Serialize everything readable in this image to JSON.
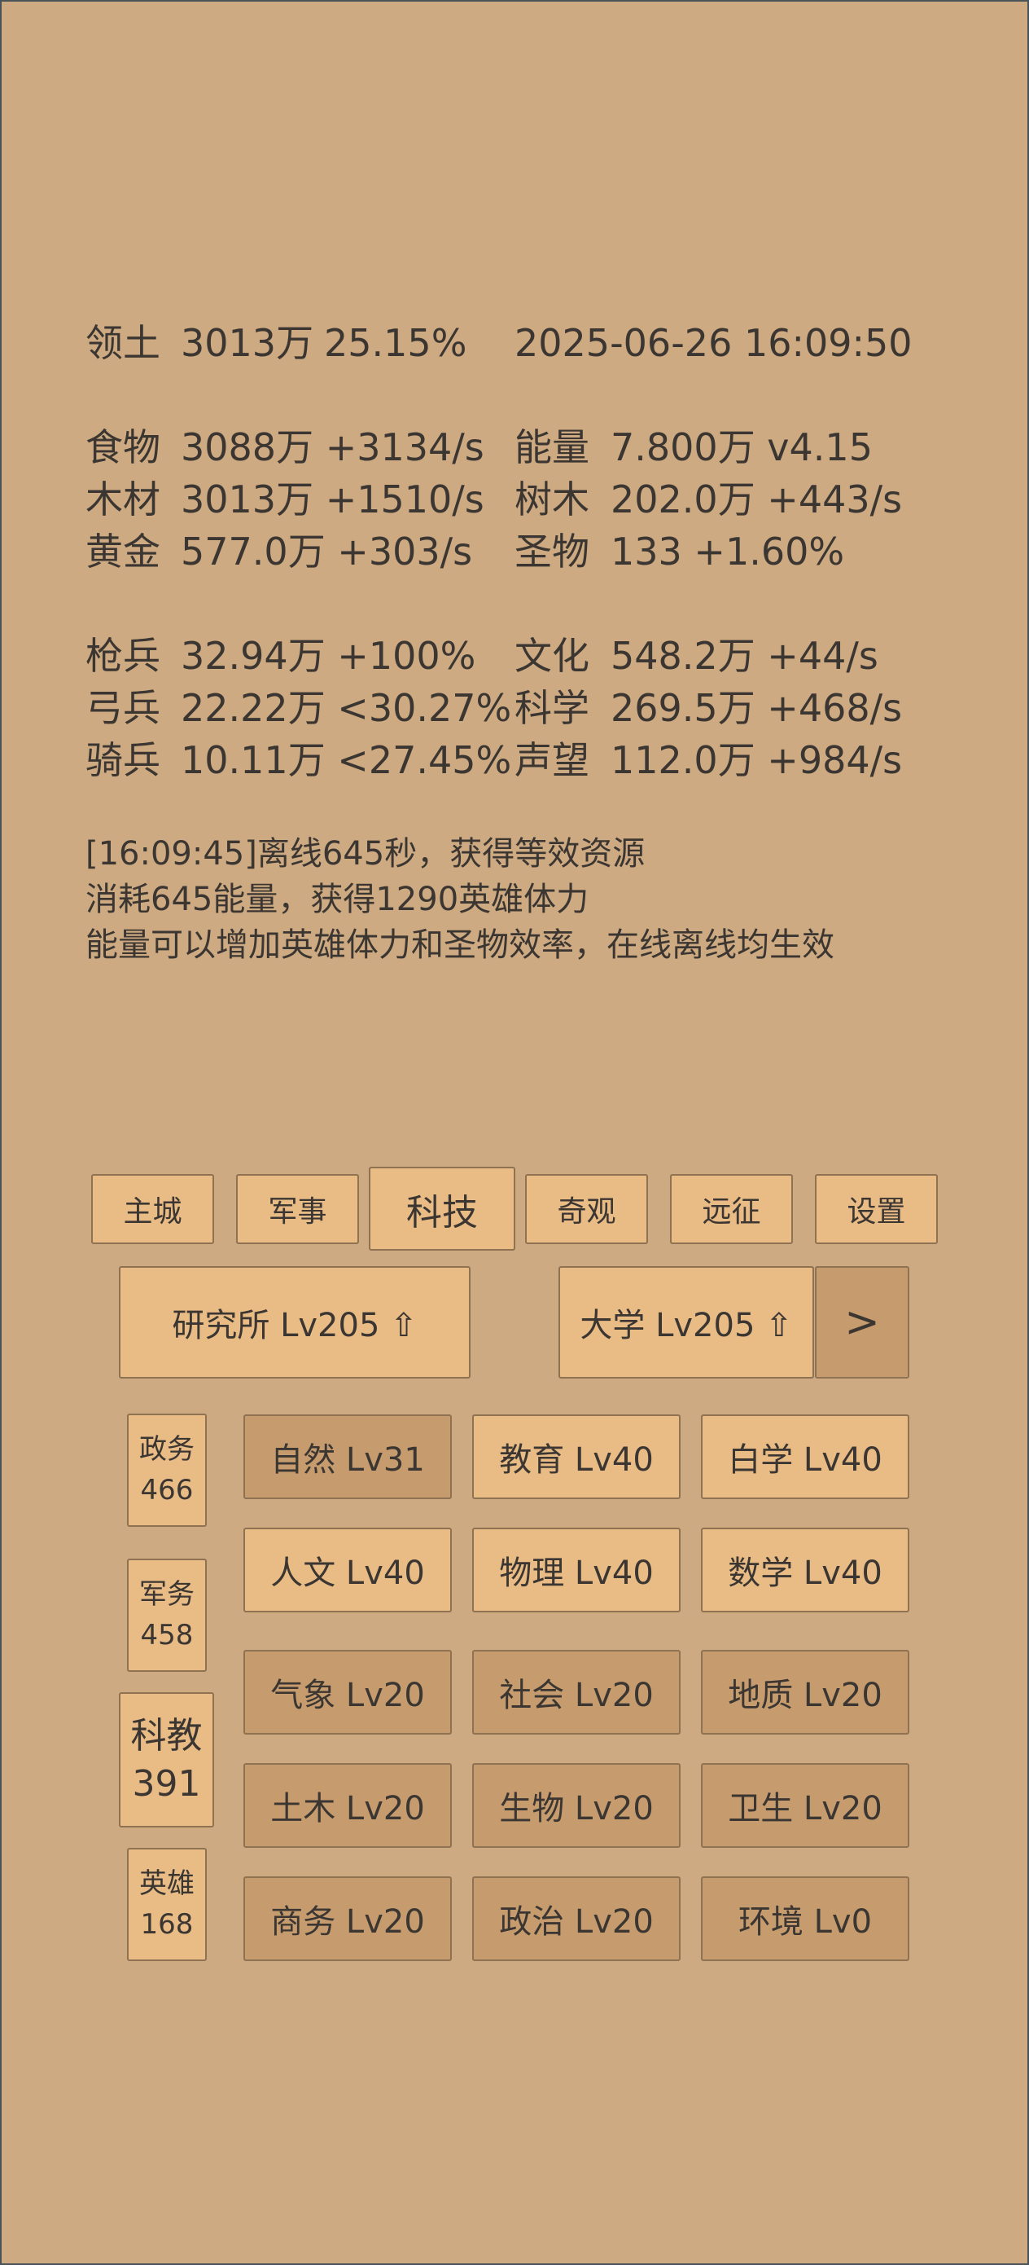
{
  "territory": {
    "label": "领土",
    "value": "3013万",
    "ratio": "25.15%"
  },
  "datetime": "2025-06-26 16:09:50",
  "resources": [
    {
      "label": "食物",
      "value": "3088万 +3134/s"
    },
    {
      "label": "木材",
      "value": "3013万 +1510/s"
    },
    {
      "label": "黄金",
      "value": "577.0万 +303/s"
    },
    {
      "label": "能量",
      "value": "7.800万  v4.15"
    },
    {
      "label": "树木",
      "value": "202.0万 +443/s"
    },
    {
      "label": "圣物",
      "value": "133 +1.60%"
    }
  ],
  "military": [
    {
      "label": "枪兵",
      "value": "32.94万 +100%"
    },
    {
      "label": "弓兵",
      "value": "22.22万 <30.27%"
    },
    {
      "label": "骑兵",
      "value": "10.11万 <27.45%"
    },
    {
      "label": "文化",
      "value": "548.2万 +44/s"
    },
    {
      "label": "科学",
      "value": "269.5万 +468/s"
    },
    {
      "label": "声望",
      "value": "112.0万 +984/s"
    }
  ],
  "log": [
    "[16:09:45]离线645秒，获得等效资源",
    "消耗645能量，获得1290英雄体力",
    "能量可以增加英雄体力和圣物效率，在线离线均生效"
  ],
  "tabs": [
    "主城",
    "军事",
    "科技",
    "奇观",
    "远征",
    "设置"
  ],
  "active_tab": "科技",
  "buildings": {
    "institute": "研究所 Lv205 ⇧",
    "university": "大学 Lv205 ⇧",
    "next": ">"
  },
  "side_menu": [
    {
      "label": "政务",
      "count": "466"
    },
    {
      "label": "军务",
      "count": "458"
    },
    {
      "label": "科教",
      "count": "391"
    },
    {
      "label": "英雄",
      "count": "168"
    }
  ],
  "techs": [
    "自然 Lv31",
    "教育 Lv40",
    "白学 Lv40",
    "人文 Lv40",
    "物理 Lv40",
    "数学 Lv40",
    "气象 Lv20",
    "社会 Lv20",
    "地质 Lv20",
    "土木 Lv20",
    "生物 Lv20",
    "卫生 Lv20",
    "商务 Lv20",
    "政治 Lv20",
    "环境 Lv0"
  ],
  "colors": {
    "background": "#cdaa81",
    "button_light": "#e9bb85",
    "button_dark": "#c69c6e",
    "text": "#3b3632"
  }
}
